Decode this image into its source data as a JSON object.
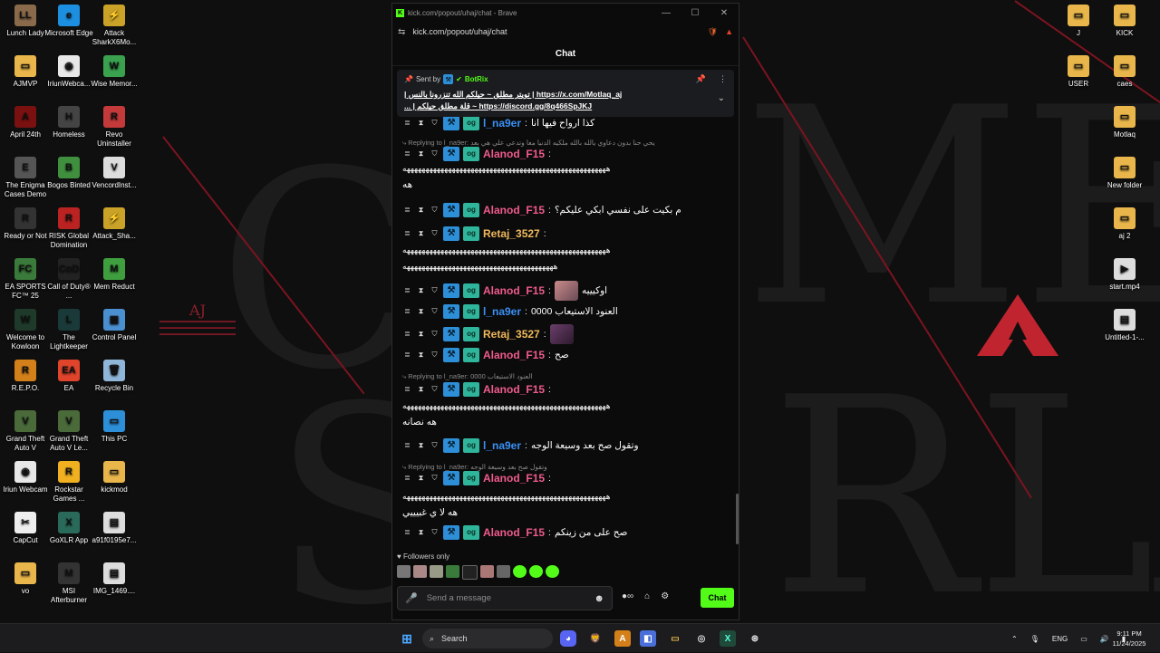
{
  "browser": {
    "title": "kick.com/popout/uhaj/chat - Brave",
    "url": "kick.com/popout/uhaj/chat",
    "controls": {
      "minimize": "—",
      "maximize": "☐",
      "close": "✕"
    }
  },
  "chat": {
    "header": "Chat",
    "pinned": {
      "sent_by": "Sent by",
      "bot": "BotRix",
      "line1": "https://x.com/Motlaq_aj | تويتر مطلق ~ حيلكم الله تنزرونا بالنس |",
      "line2": "https://discord.gg/8q466SpJKJ ~ قلة مطلق حيلكم | ..."
    },
    "messages": [
      {
        "user": "l_na9er",
        "text": "كذا ارواح فيها انا"
      },
      {
        "reply": "Replying to l_na9er: يحي حنا بدون دعاوي يالله بالله ملكيه الدنيا معا وتدعي علي هي بعد"
      },
      {
        "user": "Alanod_F15",
        "text": ":"
      },
      {
        "long": "ههههههههههههههههههههههههههههههههههههههههههههههههههههههه"
      },
      {
        "text_only": "هه"
      },
      {
        "user": "Alanod_F15",
        "text": "م بكيت على نفسي ابكي عليكم؟"
      },
      {
        "user": "Retaj_3527",
        "text": ":"
      },
      {
        "long": "ههههههههههههههههههههههههههههههههههههههههههههههههههههههه"
      },
      {
        "long2": "ههههههههههههههههههههههههههههههههههههههههه"
      },
      {
        "user": "Alanod_F15",
        "text": "اوكيييه"
      },
      {
        "user": "l_na9er",
        "text": "العنود الاستيعاب 0000"
      },
      {
        "user": "Retaj_3527",
        "text": ""
      },
      {
        "user": "Alanod_F15",
        "text": "صح"
      },
      {
        "reply": "Replying to l_na9er: 0000 العنود الاستيعاب"
      },
      {
        "user": "Alanod_F15",
        "text": ":"
      },
      {
        "long": "ههههههههههههههههههههههههههههههههههههههههههههههههههههههه"
      },
      {
        "text_only": "هه نصانه"
      },
      {
        "user": "l_na9er",
        "text": "وتقول صح بعد وسيعة الوجه"
      },
      {
        "reply": "Replying to l_na9er: وتقول صح بعد وسيعة الوجه"
      },
      {
        "user": "Alanod_F15",
        "text": ":"
      },
      {
        "long": "ههههههههههههههههههههههههههههههههههههههههههههههههههههههه"
      },
      {
        "text_only": "هه لا ي غبيييي"
      },
      {
        "user": "Alanod_F15",
        "text": "صح على من زينكم"
      }
    ],
    "followers_only": "Followers only",
    "input_placeholder": "Send a message",
    "chat_button": "Chat"
  },
  "desktop_icons": [
    {
      "label": "Lunch Lady",
      "color": "#8a6a4a",
      "glyph": "LL"
    },
    {
      "label": "Microsoft Edge",
      "color": "#1d8fe0",
      "glyph": "e"
    },
    {
      "label": "Attack SharkX6Mo...",
      "color": "#c9a227",
      "glyph": "⚡"
    },
    {
      "label": "AJMVP",
      "color": "#e8b64a",
      "glyph": "▭"
    },
    {
      "label": "IriunWebca...",
      "color": "#e8e8e8",
      "glyph": "◉"
    },
    {
      "label": "Wise Memor...",
      "color": "#3aa14f",
      "glyph": "W"
    },
    {
      "label": "April 24th",
      "color": "#7a1010",
      "glyph": "A"
    },
    {
      "label": "Homeless",
      "color": "#444",
      "glyph": "H"
    },
    {
      "label": "Revo Uninstaller",
      "color": "#c43a3a",
      "glyph": "R"
    },
    {
      "label": "The Enigma Cases Demo",
      "color": "#555",
      "glyph": "E"
    },
    {
      "label": "Bogos Binted",
      "color": "#3f8f3f",
      "glyph": "B"
    },
    {
      "label": "VencordInst...",
      "color": "#ddd",
      "glyph": "V"
    },
    {
      "label": "Ready or Not",
      "color": "#333",
      "glyph": "R"
    },
    {
      "label": "RISK Global Domination",
      "color": "#b22",
      "glyph": "R"
    },
    {
      "label": "Attack_Sha...",
      "color": "#c9a227",
      "glyph": "⚡"
    },
    {
      "label": "EA SPORTS FC™ 25",
      "color": "#3a7a3a",
      "glyph": "FC"
    },
    {
      "label": "Call of Duty® ...",
      "color": "#222",
      "glyph": "CoD"
    },
    {
      "label": "Mem Reduct",
      "color": "#3f9f3f",
      "glyph": "M"
    },
    {
      "label": "Welcome to Kowloon",
      "color": "#1f3a2a",
      "glyph": "W"
    },
    {
      "label": "The Lightkeeper",
      "color": "#1a3a3a",
      "glyph": "L"
    },
    {
      "label": "Control Panel",
      "color": "#4a8fd0",
      "glyph": "▦"
    },
    {
      "label": "R.E.P.O.",
      "color": "#d4801a",
      "glyph": "R"
    },
    {
      "label": "EA",
      "color": "#e0442b",
      "glyph": "EA"
    },
    {
      "label": "Recycle Bin",
      "color": "#8fb6d8",
      "glyph": "🗑"
    },
    {
      "label": "Grand Theft Auto V",
      "color": "#4a6a3a",
      "glyph": "V"
    },
    {
      "label": "Grand Theft Auto V Le...",
      "color": "#4a6a3a",
      "glyph": "V"
    },
    {
      "label": "This PC",
      "color": "#2d8fd8",
      "glyph": "▭"
    },
    {
      "label": "Iriun Webcam",
      "color": "#e8e8e8",
      "glyph": "◉"
    },
    {
      "label": "Rockstar Games ...",
      "color": "#f0b020",
      "glyph": "R"
    },
    {
      "label": "kickmod",
      "color": "#e8b64a",
      "glyph": "▭"
    },
    {
      "label": "CapCut",
      "color": "#eee",
      "glyph": "✂"
    },
    {
      "label": "GoXLR App",
      "color": "#2a6a5a",
      "glyph": "X"
    },
    {
      "label": "a91f0195e7...",
      "color": "#ddd",
      "glyph": "▤"
    },
    {
      "label": "vo",
      "color": "#e8b64a",
      "glyph": "▭"
    },
    {
      "label": "MSI Afterburner",
      "color": "#333",
      "glyph": "M"
    },
    {
      "label": "IMG_1469....",
      "color": "#ddd",
      "glyph": "▤"
    },
    {
      "label": "J",
      "color": "#e8b64a",
      "glyph": "▭"
    },
    {
      "label": "KICK",
      "color": "#e8b64a",
      "glyph": "▭"
    },
    {
      "label": "USER",
      "color": "#e8b64a",
      "glyph": "▭"
    },
    {
      "label": "caes",
      "color": "#e8b64a",
      "glyph": "▭"
    },
    {
      "label": "Motlaq",
      "color": "#e8b64a",
      "glyph": "▭"
    },
    {
      "label": "New folder",
      "color": "#e8b64a",
      "glyph": "▭"
    },
    {
      "label": "aj 2",
      "color": "#e8b64a",
      "glyph": "▭"
    },
    {
      "label": "start.mp4",
      "color": "#ddd",
      "glyph": "▶"
    },
    {
      "label": "Untitled-1-...",
      "color": "#ddd",
      "glyph": "▤"
    }
  ],
  "taskbar": {
    "search": "Search",
    "language": "ENG",
    "time": "9:11 PM",
    "date": "11/24/2025"
  }
}
